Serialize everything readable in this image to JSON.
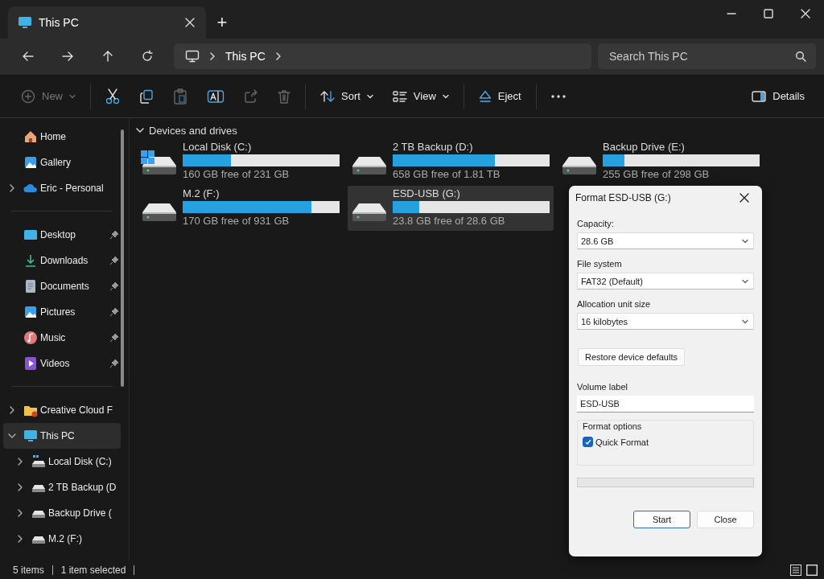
{
  "window": {
    "tab": {
      "title": "This PC",
      "selected": true
    },
    "new_tab": "+"
  },
  "nav": {
    "breadcrumb": [
      "This PC"
    ],
    "search": {
      "placeholder": "Search This PC"
    }
  },
  "toolbar": {
    "items": [
      {
        "kind": "new",
        "label": "New",
        "disabled": true
      },
      {
        "kind": "separator"
      },
      {
        "kind": "cut",
        "disabled": false
      },
      {
        "kind": "copy",
        "disabled": false
      },
      {
        "kind": "paste",
        "disabled": true
      },
      {
        "kind": "rename",
        "disabled": false
      },
      {
        "kind": "share",
        "disabled": true
      },
      {
        "kind": "delete",
        "disabled": true
      },
      {
        "kind": "separator"
      },
      {
        "kind": "sort",
        "label": "Sort",
        "disabled": false
      },
      {
        "kind": "view",
        "label": "View",
        "disabled": false
      },
      {
        "kind": "separator"
      },
      {
        "kind": "eject",
        "label": "Eject",
        "disabled": false
      },
      {
        "kind": "separator"
      },
      {
        "kind": "more",
        "disabled": false
      }
    ],
    "details": "Details"
  },
  "sidebar": {
    "groups": [
      {
        "items": [
          {
            "kind": "home",
            "label": "Home"
          },
          {
            "kind": "gallery",
            "label": "Gallery"
          },
          {
            "kind": "cloud",
            "label": "Eric - Personal",
            "expanded": false
          }
        ]
      },
      {
        "items": [
          {
            "kind": "desktop",
            "label": "Desktop",
            "pinned": true
          },
          {
            "kind": "downloads",
            "label": "Downloads",
            "pinned": true
          },
          {
            "kind": "documents",
            "label": "Documents",
            "pinned": true
          },
          {
            "kind": "pictures",
            "label": "Pictures",
            "pinned": true
          },
          {
            "kind": "music",
            "label": "Music",
            "pinned": true
          },
          {
            "kind": "videos",
            "label": "Videos",
            "pinned": true
          }
        ]
      },
      {
        "items": [
          {
            "kind": "folder",
            "label": "Creative Cloud F",
            "expanded": false
          },
          {
            "kind": "pc",
            "label": "This PC",
            "expanded": true,
            "selected": true,
            "children": [
              {
                "kind": "osdrive",
                "label": "Local Disk (C:)",
                "expanded": false
              },
              {
                "kind": "drive",
                "label": "2 TB Backup (D",
                "expanded": false
              },
              {
                "kind": "drive",
                "label": "Backup Drive (",
                "expanded": false
              },
              {
                "kind": "drive",
                "label": "M.2 (F:)",
                "expanded": false
              }
            ]
          }
        ]
      }
    ]
  },
  "content": {
    "section": {
      "title": "Devices and drives",
      "expanded": true
    },
    "drives": [
      {
        "name": "Local Disk (C:)",
        "free": "160 GB free of 231 GB",
        "level": 0.31,
        "os": true,
        "selected": false
      },
      {
        "name": "2 TB Backup (D:)",
        "free": "658 GB free of 1.81 TB",
        "level": 0.65,
        "os": false,
        "selected": false
      },
      {
        "name": "Backup Drive (E:)",
        "free": "255 GB free of 298 GB",
        "level": 0.14,
        "os": false,
        "selected": false
      },
      {
        "name": "M.2 (F:)",
        "free": "170 GB free of 931 GB",
        "level": 0.82,
        "os": false,
        "selected": false
      },
      {
        "name": "ESD-USB (G:)",
        "free": "23.8 GB free of 28.6 GB",
        "level": 0.17,
        "os": false,
        "selected": true
      }
    ]
  },
  "dialog": {
    "title": "Format ESD-USB (G:)",
    "selects": [
      {
        "label": "Capacity:",
        "value": "28.6 GB"
      },
      {
        "label": "File system",
        "value": "FAT32 (Default)"
      },
      {
        "label": "Allocation unit size",
        "value": "16 kilobytes"
      }
    ],
    "restore_button": "Restore device defaults",
    "volume_label": {
      "label": "Volume label",
      "value": "ESD-USB"
    },
    "format_options": {
      "title": "Format options",
      "checkboxes": [
        {
          "label": "Quick Format",
          "checked": true
        }
      ]
    },
    "progress": {
      "level": 0
    },
    "buttons": [
      {
        "label": "Start",
        "default": true
      },
      {
        "label": "Close",
        "default": false
      }
    ]
  },
  "status_bar": {
    "items": [
      "5 items",
      "1 item selected"
    ]
  }
}
